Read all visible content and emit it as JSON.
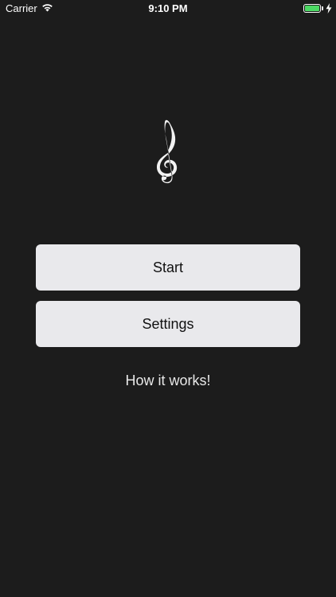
{
  "status_bar": {
    "carrier": "Carrier",
    "time": "9:10 PM",
    "battery_level": 1.0,
    "charging": true,
    "battery_color": "#4cd964"
  },
  "logo": {
    "icon": "treble-clef-icon"
  },
  "menu": {
    "start_label": "Start",
    "settings_label": "Settings",
    "how_it_works_label": "How it works!"
  },
  "colors": {
    "background": "#1c1c1c",
    "button_background": "#e9e9ec",
    "button_text": "#111111"
  }
}
